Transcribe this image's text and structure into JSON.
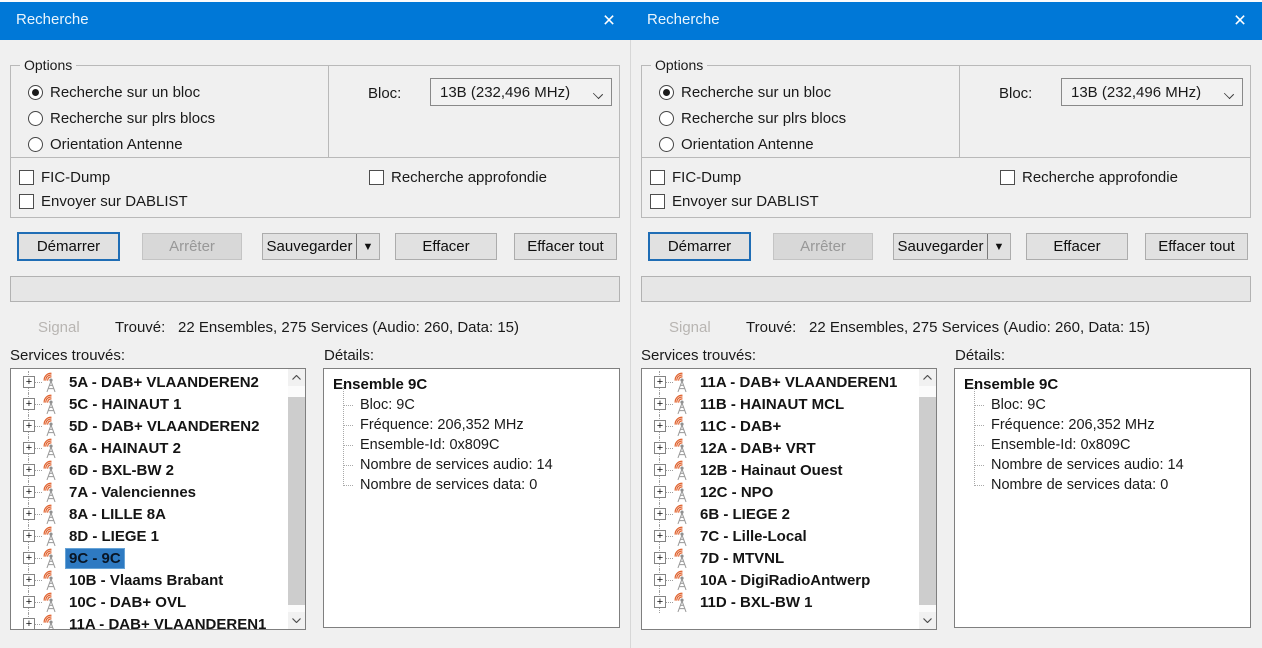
{
  "colors": {
    "titlebar_bg": "#0078d7",
    "titlebar_text": "#ffffff",
    "window_bg": "#f0f0f0",
    "selection_bg": "#2e7ac2",
    "antenna_wave": "#e0622e",
    "default_button_border": "#1f6db5"
  },
  "icons": {
    "close": "×",
    "split_arrow": "▼",
    "expand_plus": "+",
    "combo_chevron": "css-chevron-down",
    "scroll_up": "svg-chevron-up",
    "scroll_down": "svg-chevron-down",
    "transmitter": "svg-antenna-with-waves"
  },
  "windows": [
    {
      "title": "Recherche",
      "options": {
        "group_label": "Options",
        "radios": [
          {
            "label": "Recherche sur un bloc",
            "selected": true
          },
          {
            "label": "Recherche sur plrs blocs",
            "selected": false
          },
          {
            "label": "Orientation Antenne",
            "selected": false
          }
        ],
        "bloc_label": "Bloc:",
        "bloc_value": "13B (232,496 MHz)",
        "checkboxes": {
          "fic_dump": {
            "label": "FIC-Dump",
            "checked": false
          },
          "dablist": {
            "label": "Envoyer sur DABLIST",
            "checked": false
          },
          "deep_search": {
            "label": "Recherche approfondie",
            "checked": false
          }
        }
      },
      "buttons": {
        "start": "Démarrer",
        "stop": "Arrêter",
        "save": "Sauvegarder",
        "clear": "Effacer",
        "clear_all": "Effacer tout"
      },
      "progress_percent": 0,
      "status": {
        "signal_label": "Signal",
        "found_label": "Trouvé:",
        "found_value": "22 Ensembles, 275 Services (Audio: 260, Data: 15)"
      },
      "services_label": "Services trouvés:",
      "details_label": "Détails:",
      "tree": [
        {
          "label": "5A - DAB+ VLAANDEREN2"
        },
        {
          "label": "5C - HAINAUT 1"
        },
        {
          "label": "5D - DAB+ VLAANDEREN2"
        },
        {
          "label": "6A - HAINAUT 2"
        },
        {
          "label": "6D - BXL-BW 2"
        },
        {
          "label": "7A - Valenciennes"
        },
        {
          "label": "8A - LILLE 8A"
        },
        {
          "label": "8D - LIEGE 1"
        },
        {
          "label": "9C - 9C",
          "selected": true
        },
        {
          "label": "10B - Vlaams Brabant"
        },
        {
          "label": "10C - DAB+ OVL"
        },
        {
          "label": "11A - DAB+ VLAANDEREN1"
        }
      ],
      "details": {
        "title": "Ensemble 9C",
        "lines": [
          "Bloc: 9C",
          "Fréquence: 206,352 MHz",
          "Ensemble-Id: 0x809C",
          "Nombre de services audio: 14",
          "Nombre de services data: 0"
        ]
      }
    },
    {
      "title": "Recherche",
      "options": {
        "group_label": "Options",
        "radios": [
          {
            "label": "Recherche sur un bloc",
            "selected": true
          },
          {
            "label": "Recherche sur plrs blocs",
            "selected": false
          },
          {
            "label": "Orientation Antenne",
            "selected": false
          }
        ],
        "bloc_label": "Bloc:",
        "bloc_value": "13B (232,496 MHz)",
        "checkboxes": {
          "fic_dump": {
            "label": "FIC-Dump",
            "checked": false
          },
          "dablist": {
            "label": "Envoyer sur DABLIST",
            "checked": false
          },
          "deep_search": {
            "label": "Recherche approfondie",
            "checked": false
          }
        }
      },
      "buttons": {
        "start": "Démarrer",
        "stop": "Arrêter",
        "save": "Sauvegarder",
        "clear": "Effacer",
        "clear_all": "Effacer tout"
      },
      "progress_percent": 0,
      "status": {
        "signal_label": "Signal",
        "found_label": "Trouvé:",
        "found_value": "22 Ensembles, 275 Services (Audio: 260, Data: 15)"
      },
      "services_label": "Services trouvés:",
      "details_label": "Détails:",
      "tree": [
        {
          "label": "11A - DAB+ VLAANDEREN1"
        },
        {
          "label": "11B - HAINAUT MCL"
        },
        {
          "label": "11C - DAB+"
        },
        {
          "label": "12A - DAB+ VRT"
        },
        {
          "label": "12B - Hainaut Ouest"
        },
        {
          "label": "12C - NPO"
        },
        {
          "label": "6B - LIEGE 2"
        },
        {
          "label": "7C - Lille-Local"
        },
        {
          "label": "7D - MTVNL"
        },
        {
          "label": "10A - DigiRadioAntwerp"
        },
        {
          "label": "11D - BXL-BW 1"
        }
      ],
      "details": {
        "title": "Ensemble 9C",
        "lines": [
          "Bloc: 9C",
          "Fréquence: 206,352 MHz",
          "Ensemble-Id: 0x809C",
          "Nombre de services audio: 14",
          "Nombre de services data: 0"
        ]
      }
    }
  ]
}
